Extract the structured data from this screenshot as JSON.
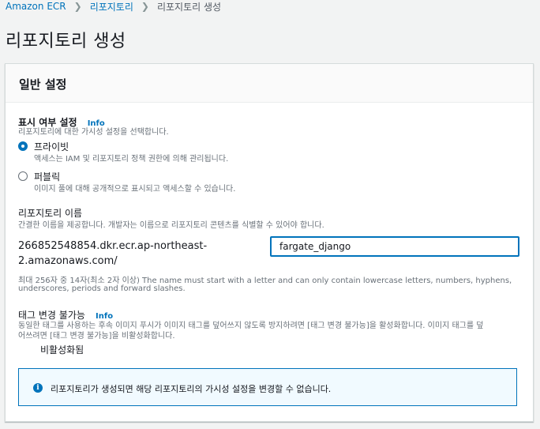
{
  "breadcrumb": {
    "items": [
      "Amazon ECR",
      "리포지토리",
      "리포지토리 생성"
    ]
  },
  "page": {
    "title": "리포지토리 생성"
  },
  "general": {
    "section_title": "일반 설정",
    "visibility": {
      "label": "표시 여부 설정",
      "info": "Info",
      "description": "리포지토리에 대한 가시성 설정을 선택합니다.",
      "options": [
        {
          "label": "프라이빗",
          "description": "액세스는 IAM 및 리포지토리 정책 권한에 의해 관리됩니다.",
          "selected": true
        },
        {
          "label": "퍼블릭",
          "description": "이미지 풀에 대해 공개적으로 표시되고 액세스할 수 있습니다.",
          "selected": false
        }
      ]
    },
    "repo_name": {
      "label": "리포지토리 이름",
      "description": "간결한 이름을 제공합니다. 개발자는 이름으로 리포지토리 콘텐츠를 식별할 수 있어야 합니다.",
      "prefix_line1": "266852548854.dkr.ecr.ap-northeast-",
      "prefix_line2": "2.amazonaws.com/",
      "value": "fargate_django",
      "constraint_line1": "최대 256자 중 14자(최소 2자 이상) The name must start with a letter and can only contain lowercase letters, numbers, hyphens,",
      "constraint_line2": "underscores, periods and forward slashes."
    },
    "tag_immutability": {
      "label": "태그 변경 불가능",
      "info": "Info",
      "description_line1": "동일한 태그를 사용하는 후속 이미지 푸시가 이미지 태그를 덮어쓰지 않도록 방지하려면 [태그 변경 불가능]을 활성화합니다. 이미지 태그를 덮",
      "description_line2": "어쓰려면 [태그 변경 불가능]을 비활성화합니다.",
      "toggle_label": "비활성화됨",
      "enabled": false
    },
    "alert": {
      "icon": "info-icon",
      "text": "리포지토리가 생성되면 해당 리포지토리의 가시성 설정을 변경할 수 없습니다."
    }
  },
  "colors": {
    "accent": "#0073bb",
    "background": "#f2f3f3",
    "alert_background": "#f1faff"
  }
}
